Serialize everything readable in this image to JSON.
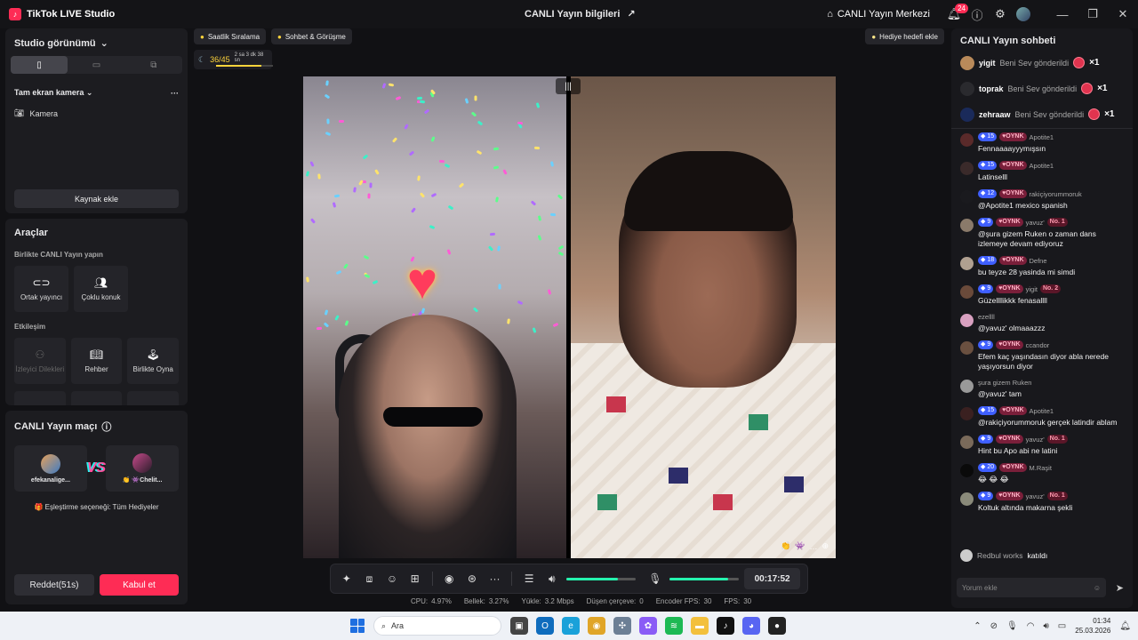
{
  "titlebar": {
    "app_name": "TikTok LIVE Studio",
    "center_title": "CANLI Yayın bilgileri",
    "live_center": "CANLI Yayın Merkezi",
    "notif_count": "24"
  },
  "left": {
    "studio_view": "Studio görünümü",
    "fullscreen_camera": "Tam ekran kamera",
    "camera_item": "Kamera",
    "add_source": "Kaynak ekle",
    "tools_title": "Araçlar",
    "go_live_together": "Birlikte CANLI Yayın yapın",
    "co_host": "Ortak yayıncı",
    "multi_guest": "Çoklu konuk",
    "interaction": "Etkileşim",
    "viewer_requests": "İzleyici Dilekleri",
    "guide": "Rehber",
    "play_together": "Birlikte Oyna"
  },
  "match": {
    "title": "CANLI Yayın maçı",
    "player1": "efekanalige...",
    "player2": "Chelit...",
    "option": "Eşleştirme seçeneği: Tüm Hediyeler",
    "reject": "Reddet(51s)",
    "accept": "Kabul et"
  },
  "center": {
    "hourly_rank": "Saatlik Sıralama",
    "chat_meet": "Sohbet & Görüşme",
    "gift_goal": "Hediye hedefi ekle",
    "rank_value": "36/45",
    "rank_timer": "2 sa 3 dk 38 sn",
    "rank_progress": 0.8,
    "timer": "00:17:52",
    "speaker_level": 0.75,
    "mic_level": 0.85
  },
  "stats": {
    "cpu_label": "CPU:",
    "cpu": "4.97%",
    "mem_label": "Bellek:",
    "mem": "3.27%",
    "upload_label": "Yükle:",
    "upload": "3.2 Mbps",
    "drop_label": "Düşen çerçeve:",
    "drop": "0",
    "encoder_label": "Encoder FPS:",
    "encoder": "30",
    "fps_label": "FPS:",
    "fps": "30"
  },
  "chat": {
    "title": "CANLI Yayın sohbeti",
    "gifts": [
      {
        "name": "yigit",
        "text": "Beni Sev gönderildi",
        "count": "×1"
      },
      {
        "name": "toprak",
        "text": "Beni Sev gönderildi",
        "count": "×1"
      },
      {
        "name": "zehraaw",
        "text": "Beni Sev gönderildi",
        "count": "×1"
      }
    ],
    "messages": [
      {
        "level": "15",
        "fan": "OYNK",
        "user": "Apotite1",
        "text": "Fennaaaayyymışsın"
      },
      {
        "level": "15",
        "fan": "OYNK",
        "user": "Apotite1",
        "text": "Latinselll"
      },
      {
        "level": "12",
        "fan": "OYNK",
        "user": "rakiçiyorummoruk",
        "text": "@Apotite1 mexico spanish"
      },
      {
        "level": "9",
        "fan": "OYNK",
        "user": "yavuz'",
        "badge": "No. 1",
        "text": "@şura gizem Ruken o zaman dans izlemeye devam ediyoruz"
      },
      {
        "level": "18",
        "fan": "OYNK",
        "user": "Defne",
        "text": "bu teyze 28 yasinda mi simdi"
      },
      {
        "level": "9",
        "fan": "OYNK",
        "user": "yigit",
        "badge": "No. 2",
        "text": "Güzellllikkk fenasallll"
      },
      {
        "user": "ezellll",
        "text": "@yavuz' olmaaazzz"
      },
      {
        "level": "9",
        "fan": "OYNK",
        "user": "ccandor",
        "text": "Efem kaç yaşındasın diyor abla nerede yaşıyorsun diyor"
      },
      {
        "user": "şura gizem Ruken",
        "text": "@yavuz' tam"
      },
      {
        "level": "15",
        "fan": "OYNK",
        "user": "Apotite1",
        "text": "@rakiçiyorummoruk gerçek latindir ablam"
      },
      {
        "level": "9",
        "fan": "OYNK",
        "user": "yavuz'",
        "badge": "No. 1",
        "text": "Hint bu Apo abi ne latini"
      },
      {
        "level": "20",
        "fan": "OYNK",
        "user": "M.Raşit",
        "text": "😂 😂 😂"
      },
      {
        "level": "9",
        "fan": "OYNK",
        "user": "yavuz'",
        "badge": "No. 1",
        "text": "Koltuk altında makarna şekli"
      }
    ],
    "join_user": "Redbul works",
    "join_text": "katıldı",
    "input_placeholder": "Yorum ekle"
  },
  "taskbar": {
    "search": "Ara",
    "time": "01:34",
    "date": "25.03.2026"
  },
  "icons": [
    "tiktok-logo-icon",
    "share-icon",
    "home-icon",
    "bell-icon",
    "help-icon",
    "gear-icon",
    "camera-icon",
    "link-icon",
    "users-icon",
    "heart-icon",
    "mic-icon",
    "speaker-icon",
    "send-icon",
    "emoji-icon",
    "windows-start-icon",
    "search-icon"
  ]
}
